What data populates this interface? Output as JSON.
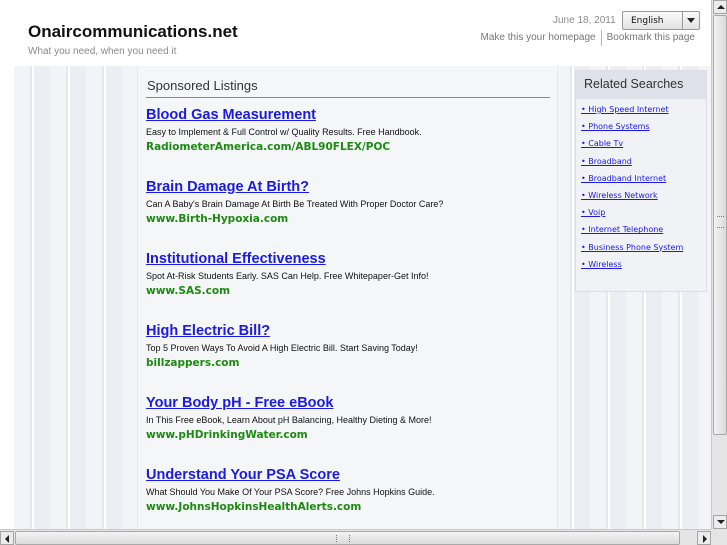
{
  "site": {
    "title": "Onaircommunications.net",
    "tagline": "What you need, when you need it"
  },
  "header": {
    "date": "June 18, 2011",
    "language": "English",
    "links": [
      "Make this your homepage",
      "Bookmark this page"
    ]
  },
  "sponsored": {
    "heading": "Sponsored Listings",
    "listings": [
      {
        "title": "Blood Gas Measurement",
        "description": "Easy to Implement & Full Control w/ Quality Results. Free Handbook.",
        "url": "RadiometerAmerica.com/ABL90FLEX/POC"
      },
      {
        "title": "Brain Damage At Birth?",
        "description": "Can A Baby's Brain Damage At Birth Be Treated With Proper Doctor Care?",
        "url": "www.Birth-Hypoxia.com"
      },
      {
        "title": "Institutional Effectiveness",
        "description": "Spot At-Risk Students Early. SAS Can Help. Free Whitepaper-Get Info!",
        "url": "www.SAS.com"
      },
      {
        "title": "High Electric Bill?",
        "description": "Top 5 Proven Ways To Avoid A High Electric Bill. Start Saving Today!",
        "url": "billzappers.com"
      },
      {
        "title": "Your Body pH - Free eBook",
        "description": "In This Free eBook, Learn About pH Balancing, Healthy Dieting & More!",
        "url": "www.pHDrinkingWater.com"
      },
      {
        "title": "Understand Your PSA Score",
        "description": "What Should You Make Of Your PSA Score? Free Johns Hopkins Guide.",
        "url": "www.JohnsHopkinsHealthAlerts.com"
      }
    ]
  },
  "related": {
    "heading": "Related Searches",
    "items": [
      "• High Speed Internet",
      "• Phone Systems",
      "• Cable Tv",
      "• Broadband",
      "• Broadband Internet",
      "• Wireless Network",
      "• Voip",
      "• Internet Telephone",
      "• Business Phone System",
      "• Wireless"
    ]
  },
  "colors": {
    "link_blue": "#1a1ae6",
    "url_green": "#1c8a12",
    "muted_gray": "#8a8a8a"
  }
}
